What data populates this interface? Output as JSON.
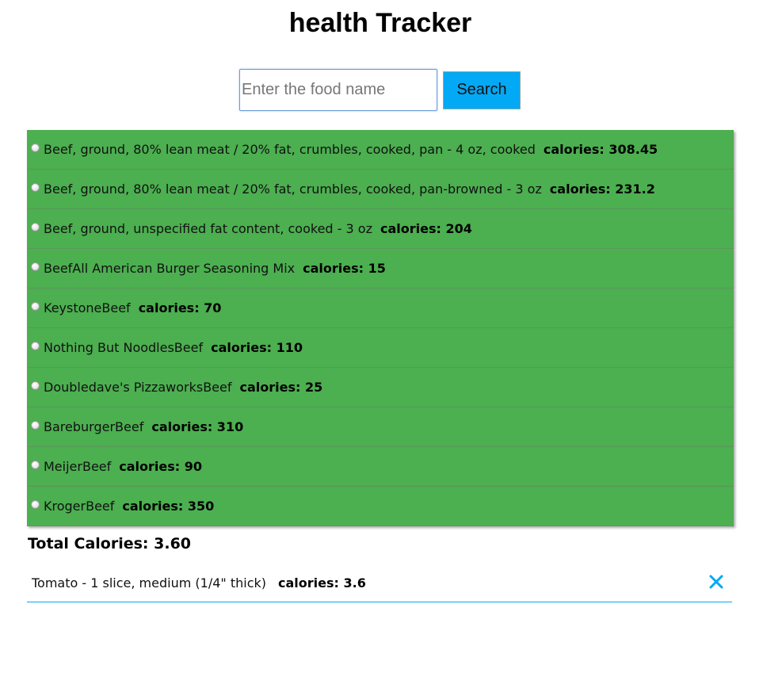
{
  "app": {
    "title": "health Tracker"
  },
  "search": {
    "placeholder": "Enter the food name",
    "value": "",
    "button_label": "Search"
  },
  "results": [
    {
      "name": "Beef, ground, 80% lean meat / 20% fat, crumbles, cooked, pan - 4 oz, cooked",
      "calories": "calories: 308.45"
    },
    {
      "name": "Beef, ground, 80% lean meat / 20% fat, crumbles, cooked, pan-browned - 3 oz",
      "calories": "calories: 231.2"
    },
    {
      "name": "Beef, ground, unspecified fat content, cooked - 3 oz",
      "calories": "calories: 204"
    },
    {
      "name": "BeefAll American Burger Seasoning Mix",
      "calories": "calories: 15"
    },
    {
      "name": "KeystoneBeef",
      "calories": "calories: 70"
    },
    {
      "name": "Nothing But NoodlesBeef",
      "calories": "calories: 110"
    },
    {
      "name": "Doubledave's PizzaworksBeef",
      "calories": "calories: 25"
    },
    {
      "name": "BareburgerBeef",
      "calories": "calories: 310"
    },
    {
      "name": "MeijerBeef",
      "calories": "calories: 90"
    },
    {
      "name": "KrogerBeef",
      "calories": "calories: 350"
    }
  ],
  "total": {
    "label": "Total Calories: 3.60"
  },
  "selected": [
    {
      "name": "Tomato - 1 slice, medium (1/4\" thick)",
      "calories": "calories: 3.6"
    }
  ],
  "colors": {
    "result_bg": "#4caf50",
    "accent": "#03a9f4"
  },
  "icons": {
    "remove": "close-icon"
  }
}
